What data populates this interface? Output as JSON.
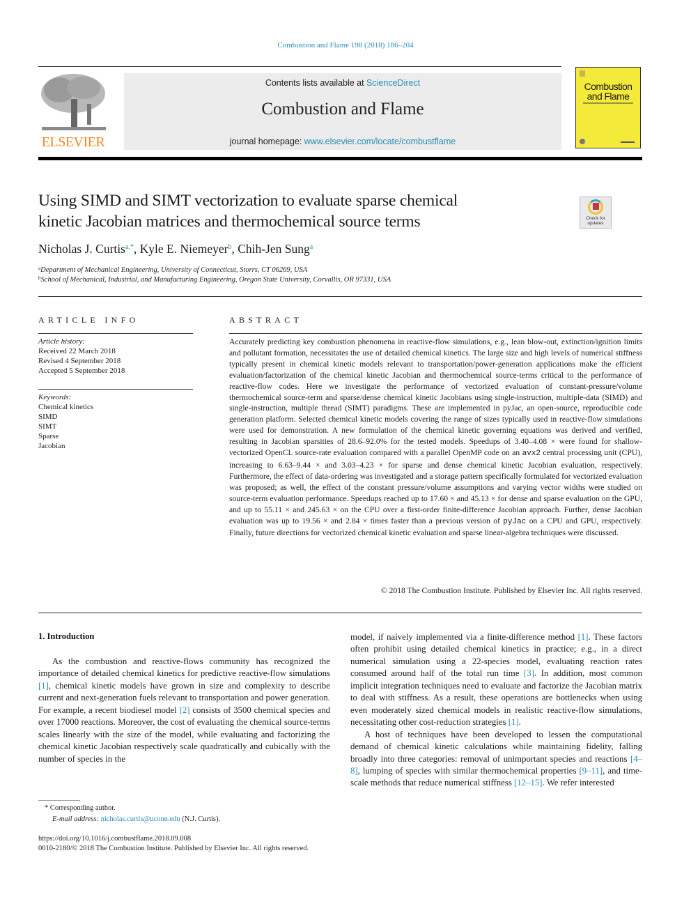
{
  "header": {
    "journal_reference": "Combustion and Flame 198 (2018) 186–204",
    "publisher_logo_text": "ELSEVIER",
    "contents_prefix": "Contents lists available at ",
    "contents_link": "ScienceDirect",
    "journal_title": "Combustion and Flame",
    "homepage_prefix": "journal homepage: ",
    "homepage_link": "www.elsevier.com/locate/combustflame",
    "cover_title_line1": "Combustion",
    "cover_title_line2": "and Flame",
    "crossmark_line1": "Check for",
    "crossmark_line2": "updates"
  },
  "article": {
    "title_line1": "Using SIMD and SIMT vectorization to evaluate sparse chemical",
    "title_line2": "kinetic Jacobian matrices and thermochemical source terms",
    "authors": [
      {
        "name": "Nicholas J. Curtis",
        "sup": "a,*"
      },
      {
        "name": "Kyle E. Niemeyer",
        "sup": "b"
      },
      {
        "name": "Chih-Jen Sung",
        "sup": "a"
      }
    ],
    "affiliations": [
      {
        "sup": "a",
        "text": "Department of Mechanical Engineering, University of Connecticut, Storrs, CT 06269, USA"
      },
      {
        "sup": "b",
        "text": "School of Mechanical, Industrial, and Manufacturing Engineering, Oregon State University, Corvallis, OR 97331, USA"
      }
    ]
  },
  "article_info": {
    "heading": "ARTICLE INFO",
    "history_label": "Article history:",
    "history": [
      "Received 22 March 2018",
      "Revised 4 September 2018",
      "Accepted 5 September 2018"
    ],
    "keywords_label": "Keywords:",
    "keywords": [
      "Chemical kinetics",
      "SIMD",
      "SIMT",
      "Sparse",
      "Jacobian"
    ]
  },
  "abstract": {
    "heading": "ABSTRACT",
    "part1": "Accurately predicting key combustion phenomena in reactive-flow simulations, e.g., lean blow-out, extinction/ignition limits and pollutant formation, necessitates the use of detailed chemical kinetics. The large size and high levels of numerical stiffness typically present in chemical kinetic models relevant to transportation/power-generation applications make the efficient evaluation/factorization of the chemical kinetic Jacobian and thermochemical source-terms critical to the performance of reactive-flow codes. Here we investigate the performance of vectorized evaluation of constant-pressure/volume thermochemical source-term and sparse/dense chemical kinetic Jacobians using single-instruction, multiple-data (SIMD) and single-instruction, multiple thread (SIMT) paradigms. These are implemented in pyJac, an open-source, reproducible code generation platform. Selected chemical kinetic models covering the range of sizes typically used in reactive-flow simulations were used for demonstration. A new formulation of the chemical kinetic governing equations was derived and verified, resulting in Jacobian sparsities of 28.6–92.0% for the tested models. Speedups of 3.40–4.08 × were found for shallow-vectorized OpenCL source-rate evaluation compared with a parallel OpenMP code on an ",
    "code1": "avx2",
    "part2": " central processing unit (CPU), increasing to 6.63–9.44 × and 3.03–4.23 × for sparse and dense chemical kinetic Jacobian evaluation, respectively. Furthermore, the effect of data-ordering was investigated and a storage pattern specifically formulated for vectorized evaluation was proposed; as well, the effect of the constant pressure/volume assumptions and varying vector widths were studied on source-term evaluation performance. Speedups reached up to 17.60 × and 45.13 × for dense and sparse evaluation on the GPU, and up to 55.11 × and 245.63 × on the CPU over a first-order finite-difference Jacobian approach. Further, dense Jacobian evaluation was up to 19.56 × and 2.84 × times faster than a previous version of ",
    "code2": "pyJac",
    "part3": " on a CPU and GPU, respectively. Finally, future directions for vectorized chemical kinetic evaluation and sparse linear-algebra techniques were discussed.",
    "copyright": "© 2018 The Combustion Institute. Published by Elsevier Inc. All rights reserved."
  },
  "body": {
    "section_heading": "1. Introduction",
    "left_col": {
      "p1_a": "As the combustion and reactive-flows community has recognized the importance of detailed chemical kinetics for predictive reactive-flow simulations ",
      "ref1": "[1]",
      "p1_b": ", chemical kinetic models have grown in size and complexity to describe current and next-generation fuels relevant to transportation and power generation. For example, a recent biodiesel model ",
      "ref2": "[2]",
      "p1_c": " consists of 3500 chemical species and over 17000 reactions. Moreover, the cost of evaluating the chemical source-terms scales linearly with the size of the model, while evaluating and factorizing the chemical kinetic Jacobian respectively scale quadratically and cubically with the number of species in the"
    },
    "right_col": {
      "p1_a": "model, if naively implemented via a finite-difference method ",
      "ref1": "[1]",
      "p1_b": ". These factors often prohibit using detailed chemical kinetics in practice; e.g., in a direct numerical simulation using a 22-species model, evaluating reaction rates consumed around half of the total run time ",
      "ref3": "[3]",
      "p1_c": ". In addition, most common implicit integration techniques need to evaluate and factorize the Jacobian matrix to deal with stiffness. As a result, these operations are bottlenecks when using even moderately sized chemical models in realistic reactive-flow simulations, necessitating other cost-reduction strategies ",
      "ref1b": "[1]",
      "p1_d": ".",
      "p2_a": "A host of techniques have been developed to lessen the computational demand of chemical kinetic calculations while maintaining fidelity, falling broadly into three categories: removal of unimportant species and reactions ",
      "ref4_8": "[4–8]",
      "p2_b": ", lumping of species with similar thermochemical properties ",
      "ref9_11": "[9–11]",
      "p2_c": ", and time-scale methods that reduce numerical stiffness ",
      "ref12_15": "[12–15]",
      "p2_d": ". We refer interested"
    }
  },
  "footnotes": {
    "corr_marker": "*",
    "corr_text": "Corresponding author.",
    "email_label": "E-mail address:",
    "email": "nicholas.curtis@uconn.edu",
    "email_suffix": " (N.J. Curtis).",
    "doi": "https://doi.org/10.1016/j.combustflame.2018.09.008",
    "issn_line": "0010-2180/© 2018 The Combustion Institute. Published by Elsevier Inc. All rights reserved."
  },
  "colors": {
    "link": "#2a8bb5",
    "elsevier_orange": "#f08a24",
    "cover_yellow": "#f4ea3a",
    "masthead_gray": "#ececec"
  }
}
